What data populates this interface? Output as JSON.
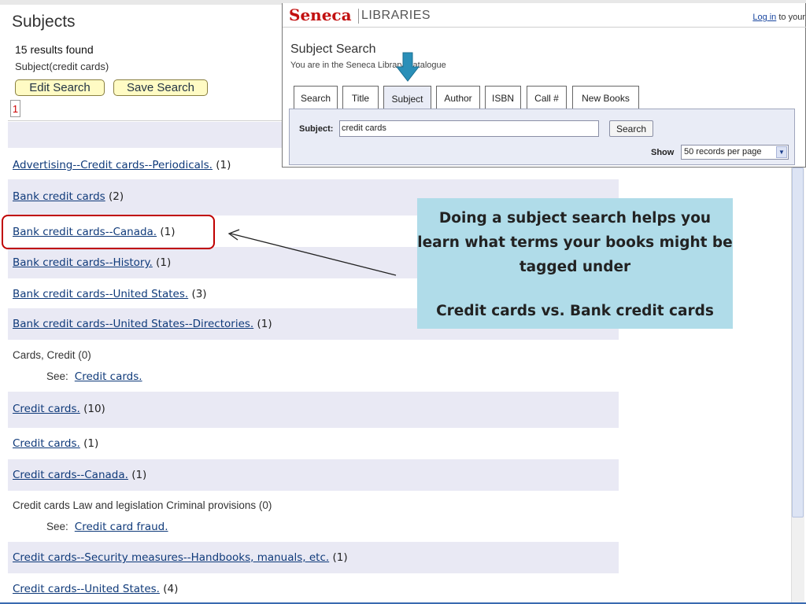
{
  "results_page": {
    "title": "Subjects",
    "results_count": "15 results found",
    "query": "Subject(credit cards)",
    "edit_search_label": "Edit Search",
    "save_search_label": "Save Search",
    "current_page": "1",
    "rows": [
      {
        "link": "Advertising--Credit cards--Periodicals.",
        "count": "(1)"
      },
      {
        "link": "Bank credit cards",
        "count": "(2)"
      },
      {
        "link": "Bank credit cards--Canada.",
        "count": "(1)"
      },
      {
        "link": "Bank credit cards--History.",
        "count": "(1)"
      },
      {
        "link": "Bank credit cards--United States.",
        "count": "(3)"
      },
      {
        "link": "Bank credit cards--United States--Directories.",
        "count": "(1)"
      },
      {
        "text": "Cards, Credit (0)",
        "see_label": "See:",
        "see_link": "Credit cards."
      },
      {
        "link": "Credit cards.",
        "count": "(10)"
      },
      {
        "link": "Credit cards.",
        "count": "(1)"
      },
      {
        "link": "Credit cards--Canada.",
        "count": "(1)"
      },
      {
        "text": "Credit cards Law and legislation Criminal provisions (0)",
        "see_label": "See:",
        "see_link": "Credit card fraud."
      },
      {
        "link": "Credit cards--Security measures--Handbooks, manuals, etc.",
        "count": "(1)"
      },
      {
        "link": "Credit cards--United States.",
        "count": "(4)"
      }
    ]
  },
  "catalogue": {
    "logo_main": "Seneca",
    "logo_sub": "LIBRARIES",
    "login_link": "Log in",
    "login_rest": " to your",
    "heading": "Subject Search",
    "subheading": "You are in the Seneca Library Catalogue",
    "tabs": [
      "Search",
      "Title",
      "Subject",
      "Author",
      "ISBN",
      "Call #",
      "New Books"
    ],
    "active_tab": "Subject",
    "subject_label": "Subject:",
    "subject_value": "credit cards",
    "search_button": "Search",
    "show_label": "Show",
    "records_selected": "50 records per page"
  },
  "callout": {
    "main_text": "Doing a subject search helps you learn what terms your books might be tagged under",
    "comparison_text": "Credit cards vs. Bank credit cards"
  },
  "colors": {
    "link": "#0f3a7a",
    "row_shade": "#e9e9f4",
    "highlight": "#c00000",
    "callout_bg": "#b0dce9",
    "arrow": "#2a8fb8",
    "brand_red": "#c21010",
    "button_yellow": "#fffbc4"
  }
}
